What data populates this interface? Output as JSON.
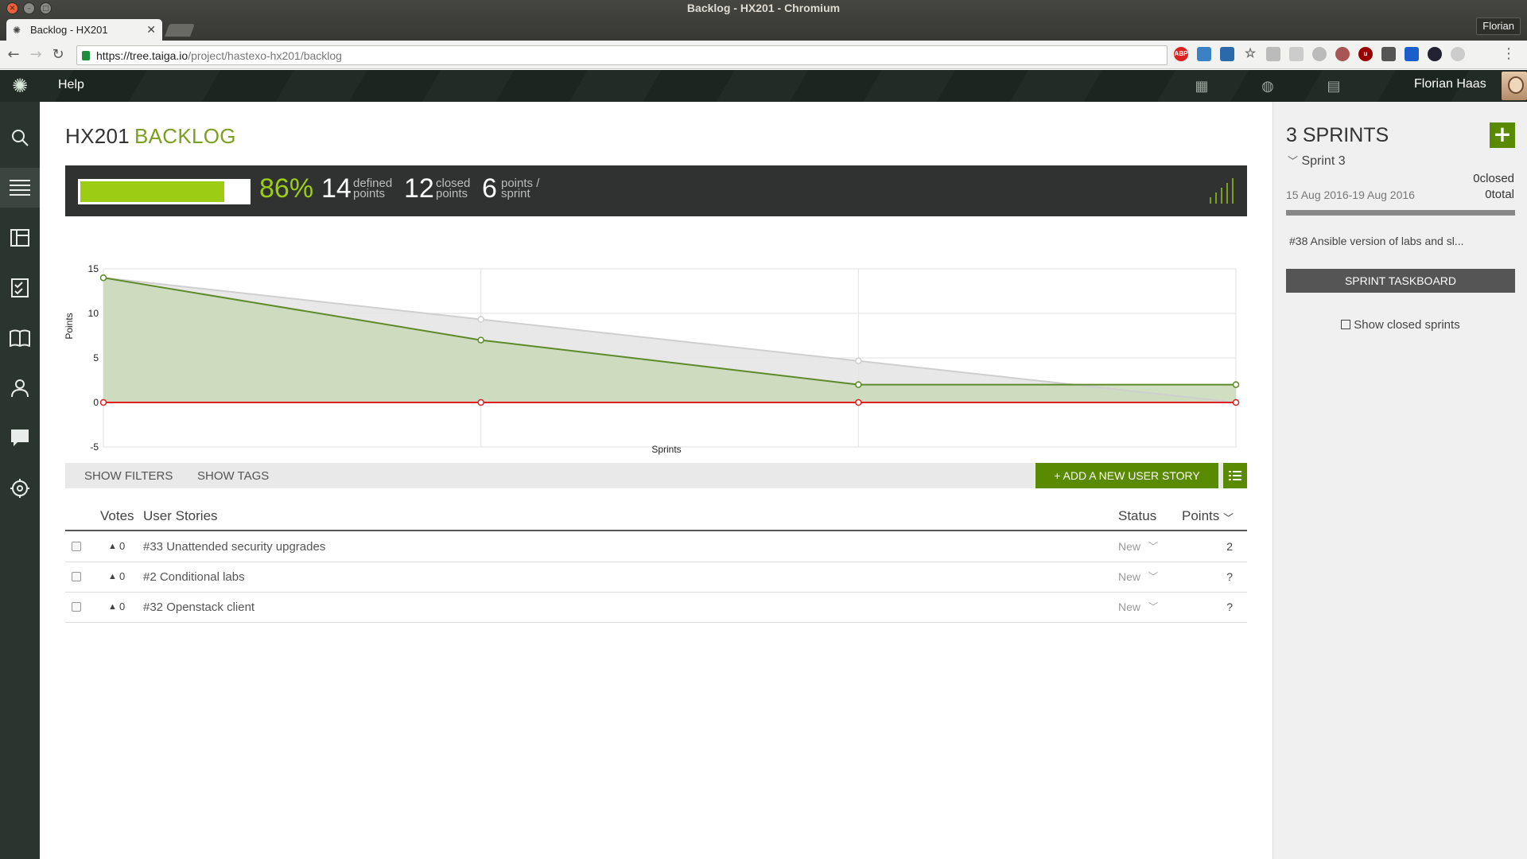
{
  "browser": {
    "window_title": "Backlog - HX201 - Chromium",
    "profile_name": "Florian",
    "tab_title": "Backlog - HX201",
    "url_host": "https://tree.taiga.io",
    "url_path": "/project/hastexo-hx201/backlog"
  },
  "topnav": {
    "help": "Help",
    "user_name": "Florian Haas"
  },
  "page": {
    "project": "HX201",
    "section": "BACKLOG"
  },
  "summary": {
    "progress_fraction": 0.86,
    "percent": "86%",
    "defined_points": "14",
    "defined_label_1": "defined",
    "defined_label_2": "points",
    "closed_points": "12",
    "closed_label_1": "closed",
    "closed_label_2": "points",
    "points_per_sprint": "6",
    "pps_label_1": "points /",
    "pps_label_2": "sprint"
  },
  "chart_data": {
    "type": "line",
    "title": "",
    "xlabel": "Sprints",
    "ylabel": "Points",
    "ylim": [
      -5,
      15
    ],
    "yticks": [
      15,
      10,
      5,
      0,
      -5
    ],
    "x": [
      0,
      1,
      2,
      3
    ],
    "series": [
      {
        "values": [
          14,
          7,
          2,
          2
        ],
        "color": "#5d8a2a",
        "fill": "#c8d9b6"
      },
      {
        "values": [
          14,
          9.33,
          4.67,
          0
        ],
        "color": "#cfcfcf",
        "fill": "#e4e4e4"
      },
      {
        "values": [
          0,
          0,
          0,
          0
        ],
        "color": "#e02020"
      }
    ],
    "grid": true
  },
  "filters": {
    "show_filters": "SHOW FILTERS",
    "show_tags": "SHOW TAGS",
    "add_story": "+ ADD A NEW USER STORY"
  },
  "table": {
    "headers": {
      "votes": "Votes",
      "stories": "User Stories",
      "status": "Status",
      "points": "Points"
    },
    "rows": [
      {
        "votes": "0",
        "subject": "#33 Unattended security upgrades",
        "status": "New",
        "points": "2"
      },
      {
        "votes": "0",
        "subject": "#2 Conditional labs",
        "status": "New",
        "points": "?"
      },
      {
        "votes": "0",
        "subject": "#32 Openstack client",
        "status": "New",
        "points": "?"
      }
    ]
  },
  "sprints": {
    "count_label": "3 SPRINTS",
    "sprint_name": "Sprint 3",
    "dates": "15 Aug 2016-19 Aug 2016",
    "closed": "0closed",
    "total": "0total",
    "story": "#38 Ansible version of labs and sl...",
    "taskboard": "SPRINT TASKBOARD",
    "show_closed": "Show closed sprints"
  }
}
